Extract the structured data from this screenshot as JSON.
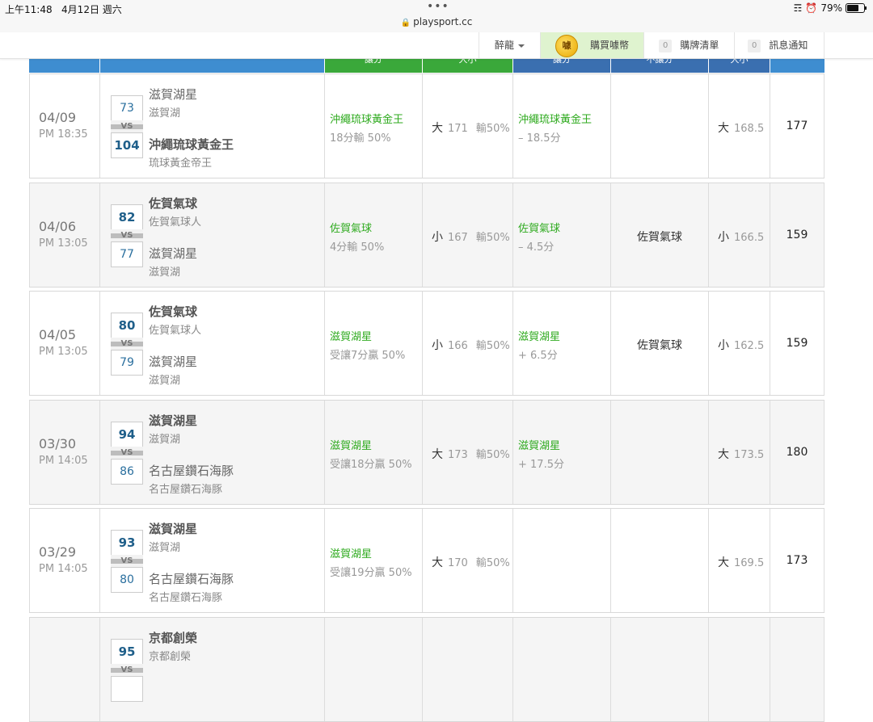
{
  "status_bar": {
    "time": "上午11:48",
    "date": "4月12日 週六",
    "battery": "79%",
    "battery_level": 0.79,
    "dots": "•••"
  },
  "address_bar": {
    "url": "playsport.cc"
  },
  "nav": {
    "drunk_label": "醉龍",
    "buy_label": "購買噱幣",
    "buy_coin_glyph": "噱",
    "cart_count": "0",
    "cart_label": "購牌清單",
    "notify_count": "0",
    "notify_label": "訊息通知"
  },
  "header_cols": [
    "",
    "",
    "讓分",
    "大小",
    "讓分",
    "不讓分",
    "大小",
    ""
  ],
  "colors": {
    "head_blue": "#3e8dd0",
    "head_green": "#3aa83a",
    "head_dark_blue": "#3a6fb0",
    "pick_green": "#2eaa1e"
  },
  "rows": [
    {
      "date": "04/09",
      "time": "PM 18:35",
      "score_top": "73",
      "score_bottom": "104",
      "vs": "VS",
      "team_top": "滋賀湖星",
      "team_top_sub": "滋賀湖",
      "team_bottom": "沖繩琉球黃金王",
      "team_bottom_sub": "琉球黃金帝王",
      "c1_pick": "沖繩琉球黃金王",
      "c1_sub": "18分輸 50%",
      "c2_side": "大",
      "c2_line": "171",
      "c2_odds": "輸50%",
      "c3_pick": "沖繩琉球黃金王",
      "c3_sub": "– 18.5分",
      "c4": "",
      "c5_side": "大",
      "c5_line": "168.5",
      "total": "177"
    },
    {
      "date": "04/06",
      "time": "PM 13:05",
      "score_top": "82",
      "score_bottom": "77",
      "vs": "VS",
      "team_top": "佐賀氣球",
      "team_top_sub": "佐賀氣球人",
      "team_bottom": "滋賀湖星",
      "team_bottom_sub": "滋賀湖",
      "c1_pick": "佐賀氣球",
      "c1_sub": "4分輸 50%",
      "c2_side": "小",
      "c2_line": "167",
      "c2_odds": "輸50%",
      "c3_pick": "佐賀氣球",
      "c3_sub": "– 4.5分",
      "c4": "佐賀氣球",
      "c5_side": "小",
      "c5_line": "166.5",
      "total": "159"
    },
    {
      "date": "04/05",
      "time": "PM 13:05",
      "score_top": "80",
      "score_bottom": "79",
      "vs": "VS",
      "team_top": "佐賀氣球",
      "team_top_sub": "佐賀氣球人",
      "team_bottom": "滋賀湖星",
      "team_bottom_sub": "滋賀湖",
      "c1_pick": "滋賀湖星",
      "c1_sub": "受讓7分贏 50%",
      "c2_side": "小",
      "c2_line": "166",
      "c2_odds": "輸50%",
      "c3_pick": "滋賀湖星",
      "c3_sub": "+ 6.5分",
      "c4": "佐賀氣球",
      "c5_side": "小",
      "c5_line": "162.5",
      "total": "159"
    },
    {
      "date": "03/30",
      "time": "PM 14:05",
      "score_top": "94",
      "score_bottom": "86",
      "vs": "VS",
      "team_top": "滋賀湖星",
      "team_top_sub": "滋賀湖",
      "team_bottom": "名古屋鑽石海豚",
      "team_bottom_sub": "名古屋鑽石海豚",
      "c1_pick": "滋賀湖星",
      "c1_sub": "受讓18分贏 50%",
      "c2_side": "大",
      "c2_line": "173",
      "c2_odds": "輸50%",
      "c3_pick": "滋賀湖星",
      "c3_sub": "+ 17.5分",
      "c4": "",
      "c5_side": "大",
      "c5_line": "173.5",
      "total": "180"
    },
    {
      "date": "03/29",
      "time": "PM 14:05",
      "score_top": "93",
      "score_bottom": "80",
      "vs": "VS",
      "team_top": "滋賀湖星",
      "team_top_sub": "滋賀湖",
      "team_bottom": "名古屋鑽石海豚",
      "team_bottom_sub": "名古屋鑽石海豚",
      "c1_pick": "滋賀湖星",
      "c1_sub": "受讓19分贏 50%",
      "c2_side": "大",
      "c2_line": "170",
      "c2_odds": "輸50%",
      "c3_pick": "",
      "c3_sub": "",
      "c4": "",
      "c5_side": "大",
      "c5_line": "169.5",
      "total": "173"
    },
    {
      "date": "",
      "time": "",
      "score_top": "95",
      "score_bottom": "",
      "vs": "VS",
      "team_top": "京都創榮",
      "team_top_sub": "京都創榮",
      "team_bottom": "",
      "team_bottom_sub": "",
      "c1_pick": "",
      "c1_sub": "",
      "c2_side": "",
      "c2_line": "",
      "c2_odds": "",
      "c3_pick": "",
      "c3_sub": "",
      "c4": "",
      "c5_side": "",
      "c5_line": "",
      "total": ""
    }
  ]
}
